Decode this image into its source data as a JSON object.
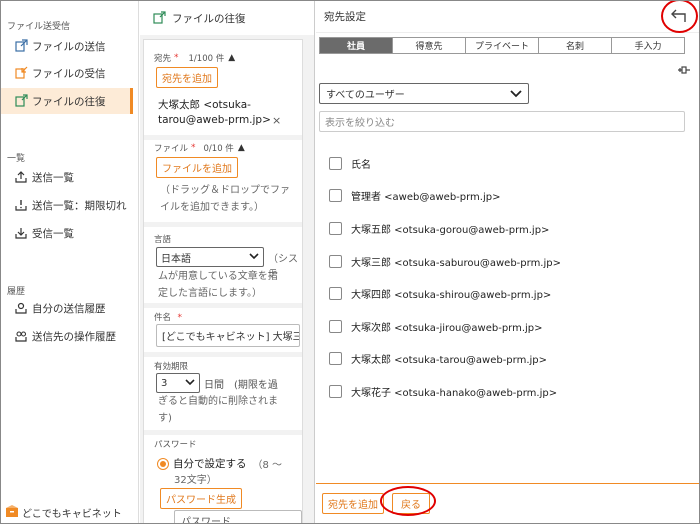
{
  "sidebar": {
    "section1": "ファイル送受信",
    "items1": [
      {
        "label": "ファイルの送信",
        "icon": "send-file-icon"
      },
      {
        "label": "ファイルの受信",
        "icon": "receive-file-icon"
      },
      {
        "label": "ファイルの往復",
        "icon": "roundtrip-file-icon"
      }
    ],
    "section2": "一覧",
    "items2": [
      {
        "label": "送信一覧",
        "icon": "upload-list-icon"
      },
      {
        "label": "送信一覧：期限切れ",
        "icon": "expired-list-icon"
      },
      {
        "label": "受信一覧",
        "icon": "download-list-icon"
      }
    ],
    "section3": "履歴",
    "items3": [
      {
        "label": "自分の送信履歴",
        "icon": "send-history-icon"
      },
      {
        "label": "送信先の操作履歴",
        "icon": "recipient-history-icon"
      }
    ],
    "logo": "どこでもキャビネット"
  },
  "middle": {
    "title": "ファイルの往復",
    "recipient_label": "宛先",
    "recipient_count": "1/100 件",
    "add_recipient": "宛先を追加",
    "recipient_line1": "大塚太郎 <otsuka-",
    "recipient_line2": "tarou@aweb-prm.jp>",
    "file_label": "ファイル",
    "file_count": "0/10 件",
    "add_file": "ファイルを追加",
    "file_hint_1": "（ドラッグ＆ドロップでファ",
    "file_hint_2": "イルを追加できます。）",
    "language_label": "言語",
    "language_value": "日本語",
    "language_hint_1": "（システ",
    "language_hint_2": "ムが用意している文章を指",
    "language_hint_3": "定した言語にします。）",
    "subject_label": "件名",
    "subject_value": "[どこでもキャビネット] 大塚三",
    "expiry_label": "有効期限",
    "expiry_value": "3",
    "expiry_hint_1": "日間　(期限を過",
    "expiry_hint_2": "ぎると自動的に削除されま",
    "expiry_hint_3": "す)",
    "password_label": "パスワード",
    "password_option": "自分で設定する",
    "password_option_hint_1": "（8 〜",
    "password_option_hint_2": "32文字）",
    "password_generate": "パスワード生成",
    "password_placeholder": "パスワード"
  },
  "panel": {
    "title": "宛先設定",
    "tabs": [
      "社員",
      "得意先",
      "プライベート",
      "名刺",
      "手入力"
    ],
    "user_select": "すべてのユーザー",
    "filter_placeholder": "表示を絞り込む",
    "header_col": "氏名",
    "rows": [
      "管理者 <aweb@aweb-prm.jp>",
      "大塚五郎 <otsuka-gorou@aweb-prm.jp>",
      "大塚三郎 <otsuka-saburou@aweb-prm.jp>",
      "大塚四郎 <otsuka-shirou@aweb-prm.jp>",
      "大塚次郎 <otsuka-jirou@aweb-prm.jp>",
      "大塚太郎 <otsuka-tarou@aweb-prm.jp>",
      "大塚花子 <otsuka-hanako@aweb-prm.jp>"
    ],
    "add_button": "宛先を追加",
    "back_button": "戻る"
  },
  "colors": {
    "accent": "#f08a24",
    "highlight": "#e00000",
    "active_bg": "#fdebd7"
  }
}
